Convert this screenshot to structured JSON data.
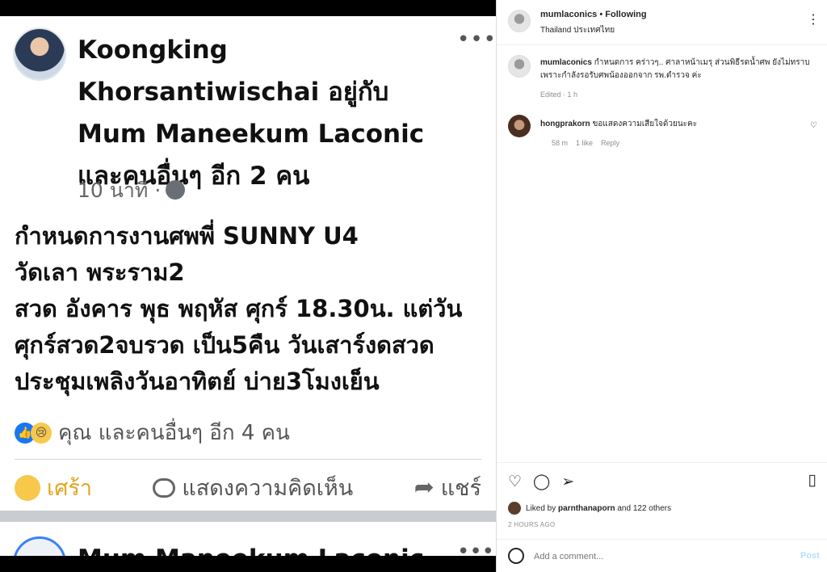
{
  "fb_post": {
    "author_line1": "Koongking",
    "author_line2_name": "Khorsantiwischai",
    "author_line2_suffix": " อยู่กับ",
    "author_line3": "Mum Maneekum Laconic",
    "author_line4": "และคนอื่นๆ อีก 2 คน",
    "time": "10 นาที ·",
    "body": "กำหนดการงานศพพี่ SUNNY U4\nวัดเลา พระราม2\n สวด อังคาร พุธ พฤหัส ศุกร์ 18.30น. แต่วันศุกร์สวด2จบรวด เป็น5คืน วันเสาร์งดสวด\nประชุมเพลิงวันอาทิตย์ บ่าย3โมงเย็น",
    "reactions_text": "คุณ และคนอื่นๆ อีก 4 คน",
    "action_sad": "เศร้า",
    "action_comment": "แสดงความคิดเห็น",
    "action_share": "แชร์",
    "more": "•••",
    "next_post_name": "Mum Maneekum Laconic"
  },
  "ig": {
    "username": "mumlaconics",
    "following": "Following",
    "location": "Thailand ประเทศไทย",
    "caption_user": "mumlaconics",
    "caption_text": " กำหนดการ คร่าวๆ.. ศาลาหน้าเมรุ ส่วนพิธีรดน้ำศพ ยังไม่ทราบ เพราะกำลังรอรับศพน้องออกจาก รพ.ตำรวจ ค่ะ",
    "edited": "Edited · 1 h",
    "comment_user": "hongprakorn",
    "comment_text": " ขอแสดงความเสียใจด้วยนะคะ",
    "comment_time": "58 m",
    "comment_likes": "1 like",
    "comment_reply": "Reply",
    "liked_by_prefix": "Liked by ",
    "liked_by_user": "parnthanaporn",
    "liked_by_suffix": " and 122 others",
    "date": "2 HOURS AGO",
    "add_comment_placeholder": "Add a comment...",
    "post_label": "Post"
  },
  "colors": {
    "fb_blue": "#1877f2",
    "sad_yellow": "#f7c84a",
    "ig_text": "#262626",
    "ig_muted": "#8e8e8e",
    "ig_post_disabled": "#b2dffc"
  }
}
